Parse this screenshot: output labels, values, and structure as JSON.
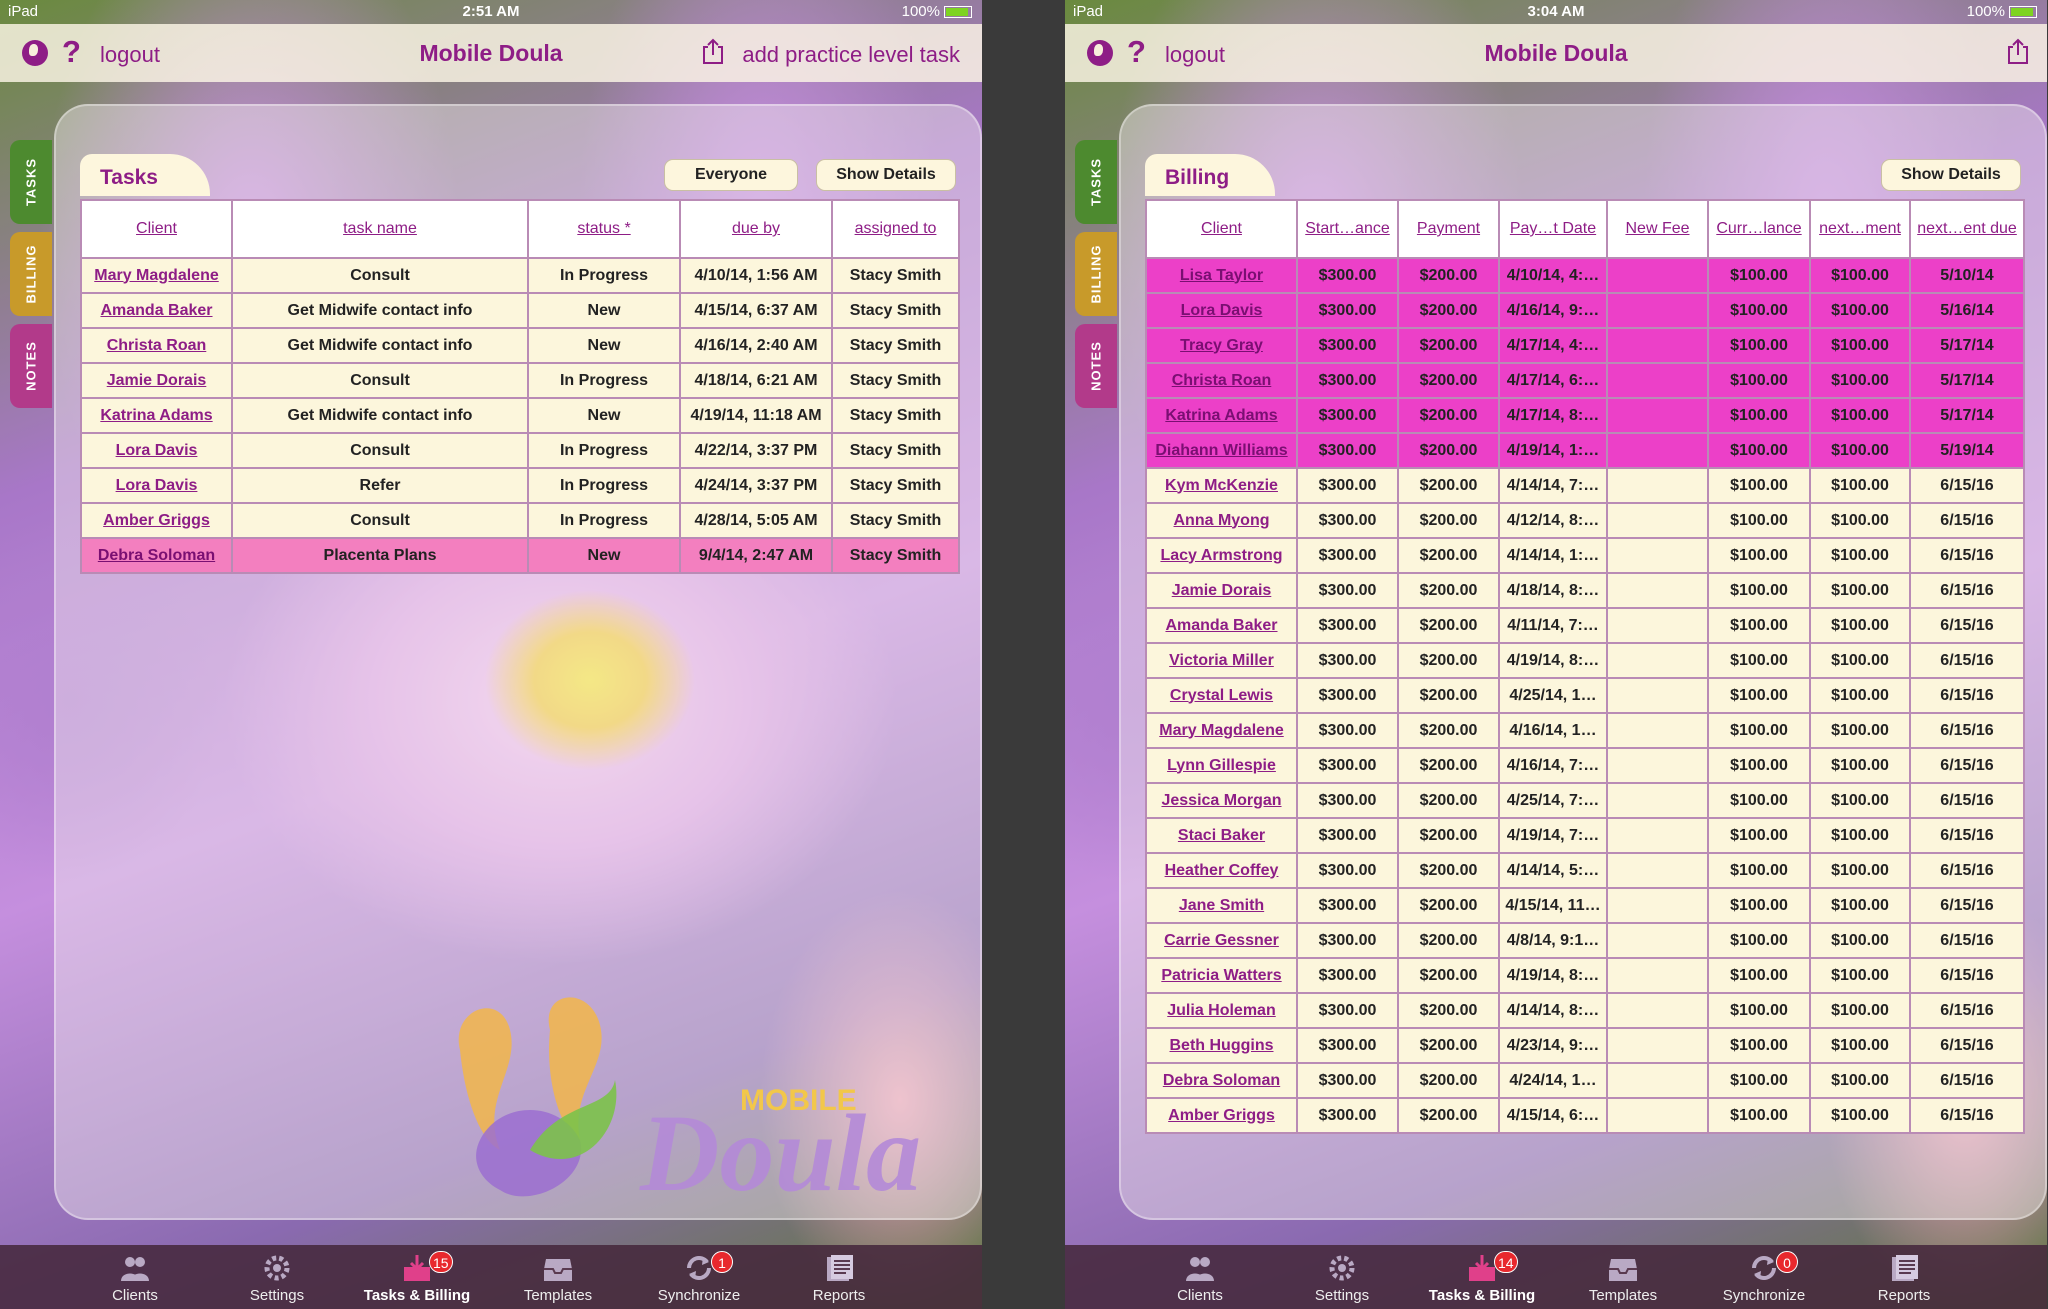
{
  "colors": {
    "brand_purple": "#8e1d86",
    "overdue_row": "#f37fbf",
    "pastdue_row": "#ec40c8",
    "cell_bg": "#fcf6dc",
    "tasks_tab": "#4d8a2f",
    "billing_tab": "#c89a2a",
    "notes_tab": "#b23a8a"
  },
  "left": {
    "status": {
      "carrier": "iPad",
      "time": "2:51 AM",
      "battery": "100%"
    },
    "nav": {
      "title": "Mobile Doula",
      "logout": "logout",
      "help": "?",
      "add_task": "add practice level task"
    },
    "side_tabs": {
      "tasks": "TASKS",
      "billing": "BILLING",
      "notes": "NOTES"
    },
    "card": {
      "tab": "Tasks",
      "everyone_button": "Everyone",
      "show_details_button": "Show Details"
    },
    "columns": [
      "Client",
      "task name",
      "status *",
      "due by",
      "assigned to"
    ],
    "rows": [
      {
        "client": "Mary Magdalene",
        "task": "Consult",
        "status": "In Progress",
        "due": "4/10/14, 1:56 AM",
        "assigned": "Stacy Smith"
      },
      {
        "client": "Amanda Baker",
        "task": "Get Midwife contact info",
        "status": "New",
        "due": "4/15/14, 6:37 AM",
        "assigned": "Stacy Smith"
      },
      {
        "client": "Christa Roan",
        "task": "Get Midwife contact info",
        "status": "New",
        "due": "4/16/14, 2:40 AM",
        "assigned": "Stacy Smith"
      },
      {
        "client": "Jamie Dorais",
        "task": "Consult",
        "status": "In Progress",
        "due": "4/18/14, 6:21 AM",
        "assigned": "Stacy Smith"
      },
      {
        "client": "Katrina Adams",
        "task": "Get Midwife contact info",
        "status": "New",
        "due": "4/19/14, 11:18 AM",
        "assigned": "Stacy Smith"
      },
      {
        "client": "Lora Davis",
        "task": "Consult",
        "status": "In Progress",
        "due": "4/22/14, 3:37 PM",
        "assigned": "Stacy Smith"
      },
      {
        "client": "Lora Davis",
        "task": "Refer",
        "status": "In Progress",
        "due": "4/24/14, 3:37 PM",
        "assigned": "Stacy Smith"
      },
      {
        "client": "Amber Griggs",
        "task": "Consult",
        "status": "In Progress",
        "due": "4/28/14, 5:05 AM",
        "assigned": "Stacy Smith"
      },
      {
        "client": "Debra Soloman",
        "task": "Placenta Plans",
        "status": "New",
        "due": "9/4/14, 2:47 AM",
        "assigned": "Stacy Smith",
        "highlight": true
      }
    ],
    "logo": {
      "small": "MOBILE",
      "large": "Doula"
    },
    "tabbar": [
      {
        "label": "Clients",
        "icon": "clients-icon"
      },
      {
        "label": "Settings",
        "icon": "settings-gear-icon"
      },
      {
        "label": "Tasks & Billing",
        "icon": "tasks-billing-icon",
        "badge": "15",
        "active": true
      },
      {
        "label": "Templates",
        "icon": "templates-tray-icon"
      },
      {
        "label": "Synchronize",
        "icon": "sync-icon",
        "badge": "1"
      },
      {
        "label": "Reports",
        "icon": "reports-icon"
      }
    ]
  },
  "right": {
    "status": {
      "carrier": "iPad",
      "time": "3:04 AM",
      "battery": "100%"
    },
    "nav": {
      "title": "Mobile Doula",
      "logout": "logout",
      "help": "?"
    },
    "side_tabs": {
      "tasks": "TASKS",
      "billing": "BILLING",
      "notes": "NOTES"
    },
    "card": {
      "tab": "Billing",
      "show_details_button": "Show Details"
    },
    "columns": [
      "Client",
      "Start…ance",
      "Payment",
      "Pay…t Date",
      "New Fee",
      "Curr…lance",
      "next…ment",
      "next…ent due"
    ],
    "rows": [
      {
        "client": "Lisa Taylor",
        "start": "$300.00",
        "payment": "$200.00",
        "paydate": "4/10/14, 4:…",
        "fee": "",
        "current": "$100.00",
        "next": "$100.00",
        "due": "5/10/14",
        "pastdue": true
      },
      {
        "client": "Lora Davis",
        "start": "$300.00",
        "payment": "$200.00",
        "paydate": "4/16/14, 9:…",
        "fee": "",
        "current": "$100.00",
        "next": "$100.00",
        "due": "5/16/14",
        "pastdue": true
      },
      {
        "client": "Tracy Gray",
        "start": "$300.00",
        "payment": "$200.00",
        "paydate": "4/17/14, 4:…",
        "fee": "",
        "current": "$100.00",
        "next": "$100.00",
        "due": "5/17/14",
        "pastdue": true
      },
      {
        "client": "Christa Roan",
        "start": "$300.00",
        "payment": "$200.00",
        "paydate": "4/17/14, 6:…",
        "fee": "",
        "current": "$100.00",
        "next": "$100.00",
        "due": "5/17/14",
        "pastdue": true
      },
      {
        "client": "Katrina Adams",
        "start": "$300.00",
        "payment": "$200.00",
        "paydate": "4/17/14, 8:…",
        "fee": "",
        "current": "$100.00",
        "next": "$100.00",
        "due": "5/17/14",
        "pastdue": true
      },
      {
        "client": "Diahann Williams",
        "start": "$300.00",
        "payment": "$200.00",
        "paydate": "4/19/14, 1:…",
        "fee": "",
        "current": "$100.00",
        "next": "$100.00",
        "due": "5/19/14",
        "pastdue": true
      },
      {
        "client": "Kym McKenzie",
        "start": "$300.00",
        "payment": "$200.00",
        "paydate": "4/14/14, 7:…",
        "fee": "",
        "current": "$100.00",
        "next": "$100.00",
        "due": "6/15/16"
      },
      {
        "client": "Anna Myong",
        "start": "$300.00",
        "payment": "$200.00",
        "paydate": "4/12/14, 8:…",
        "fee": "",
        "current": "$100.00",
        "next": "$100.00",
        "due": "6/15/16"
      },
      {
        "client": "Lacy Armstrong",
        "start": "$300.00",
        "payment": "$200.00",
        "paydate": "4/14/14, 1:…",
        "fee": "",
        "current": "$100.00",
        "next": "$100.00",
        "due": "6/15/16"
      },
      {
        "client": "Jamie Dorais",
        "start": "$300.00",
        "payment": "$200.00",
        "paydate": "4/18/14, 8:…",
        "fee": "",
        "current": "$100.00",
        "next": "$100.00",
        "due": "6/15/16"
      },
      {
        "client": "Amanda Baker",
        "start": "$300.00",
        "payment": "$200.00",
        "paydate": "4/11/14, 7:…",
        "fee": "",
        "current": "$100.00",
        "next": "$100.00",
        "due": "6/15/16"
      },
      {
        "client": "Victoria Miller",
        "start": "$300.00",
        "payment": "$200.00",
        "paydate": "4/19/14, 8:…",
        "fee": "",
        "current": "$100.00",
        "next": "$100.00",
        "due": "6/15/16"
      },
      {
        "client": "Crystal Lewis",
        "start": "$300.00",
        "payment": "$200.00",
        "paydate": "4/25/14, 1…",
        "fee": "",
        "current": "$100.00",
        "next": "$100.00",
        "due": "6/15/16"
      },
      {
        "client": "Mary Magdalene",
        "start": "$300.00",
        "payment": "$200.00",
        "paydate": "4/16/14, 1…",
        "fee": "",
        "current": "$100.00",
        "next": "$100.00",
        "due": "6/15/16"
      },
      {
        "client": "Lynn Gillespie",
        "start": "$300.00",
        "payment": "$200.00",
        "paydate": "4/16/14, 7:…",
        "fee": "",
        "current": "$100.00",
        "next": "$100.00",
        "due": "6/15/16"
      },
      {
        "client": "Jessica Morgan",
        "start": "$300.00",
        "payment": "$200.00",
        "paydate": "4/25/14, 7:…",
        "fee": "",
        "current": "$100.00",
        "next": "$100.00",
        "due": "6/15/16"
      },
      {
        "client": "Staci Baker",
        "start": "$300.00",
        "payment": "$200.00",
        "paydate": "4/19/14, 7:…",
        "fee": "",
        "current": "$100.00",
        "next": "$100.00",
        "due": "6/15/16"
      },
      {
        "client": "Heather Coffey",
        "start": "$300.00",
        "payment": "$200.00",
        "paydate": "4/14/14, 5:…",
        "fee": "",
        "current": "$100.00",
        "next": "$100.00",
        "due": "6/15/16"
      },
      {
        "client": "Jane Smith",
        "start": "$300.00",
        "payment": "$200.00",
        "paydate": "4/15/14, 11…",
        "fee": "",
        "current": "$100.00",
        "next": "$100.00",
        "due": "6/15/16"
      },
      {
        "client": "Carrie Gessner",
        "start": "$300.00",
        "payment": "$200.00",
        "paydate": "4/8/14, 9:1…",
        "fee": "",
        "current": "$100.00",
        "next": "$100.00",
        "due": "6/15/16"
      },
      {
        "client": "Patricia Watters",
        "start": "$300.00",
        "payment": "$200.00",
        "paydate": "4/19/14, 8:…",
        "fee": "",
        "current": "$100.00",
        "next": "$100.00",
        "due": "6/15/16"
      },
      {
        "client": "Julia Holeman",
        "start": "$300.00",
        "payment": "$200.00",
        "paydate": "4/14/14, 8:…",
        "fee": "",
        "current": "$100.00",
        "next": "$100.00",
        "due": "6/15/16"
      },
      {
        "client": "Beth Huggins",
        "start": "$300.00",
        "payment": "$200.00",
        "paydate": "4/23/14, 9:…",
        "fee": "",
        "current": "$100.00",
        "next": "$100.00",
        "due": "6/15/16"
      },
      {
        "client": "Debra Soloman",
        "start": "$300.00",
        "payment": "$200.00",
        "paydate": "4/24/14, 1…",
        "fee": "",
        "current": "$100.00",
        "next": "$100.00",
        "due": "6/15/16"
      },
      {
        "client": "Amber Griggs",
        "start": "$300.00",
        "payment": "$200.00",
        "paydate": "4/15/14, 6:…",
        "fee": "",
        "current": "$100.00",
        "next": "$100.00",
        "due": "6/15/16"
      }
    ],
    "tabbar": [
      {
        "label": "Clients",
        "icon": "clients-icon"
      },
      {
        "label": "Settings",
        "icon": "settings-gear-icon"
      },
      {
        "label": "Tasks & Billing",
        "icon": "tasks-billing-icon",
        "badge": "14",
        "active": true
      },
      {
        "label": "Templates",
        "icon": "templates-tray-icon"
      },
      {
        "label": "Synchronize",
        "icon": "sync-icon",
        "badge": "0"
      },
      {
        "label": "Reports",
        "icon": "reports-icon"
      }
    ]
  }
}
